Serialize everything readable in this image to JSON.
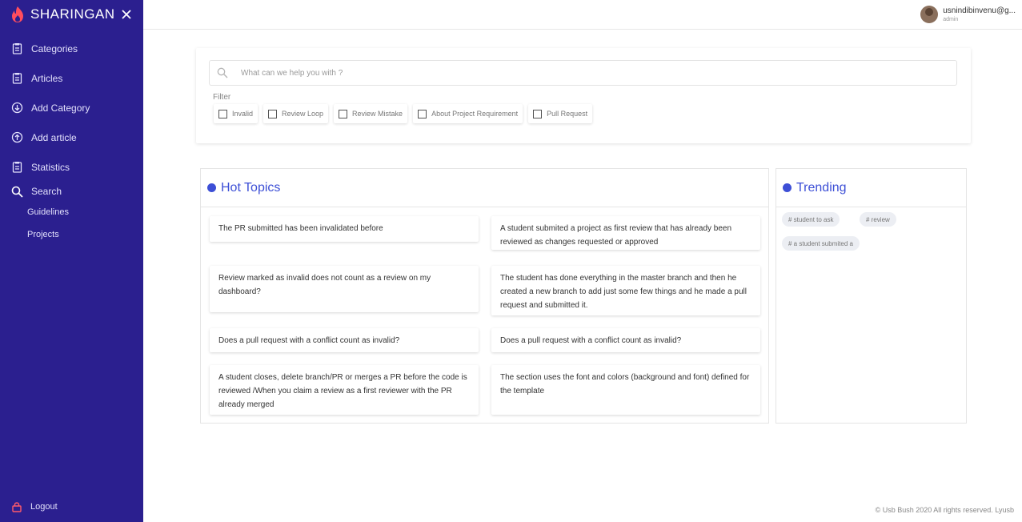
{
  "app": {
    "name": "SHARINGAN"
  },
  "sidebar": {
    "items": [
      {
        "label": "Categories",
        "icon": "clipboard-icon"
      },
      {
        "label": "Articles",
        "icon": "clipboard-icon"
      },
      {
        "label": "Add Category",
        "icon": "circle-down-icon"
      },
      {
        "label": "Add article",
        "icon": "circle-up-icon"
      },
      {
        "label": "Statistics",
        "icon": "clipboard-icon"
      },
      {
        "label": "Search",
        "icon": "search-icon"
      }
    ],
    "subitems": [
      {
        "label": "Guidelines"
      },
      {
        "label": "Projects"
      }
    ],
    "logout": "Logout"
  },
  "user": {
    "email": "usnindibinvenu@g...",
    "role": "admin"
  },
  "search": {
    "placeholder": "What can we help you with ?",
    "filter_label": "Filter",
    "filters": [
      "Invalid",
      "Review Loop",
      "Review Mistake",
      "About Project Requirement",
      "Pull Request"
    ]
  },
  "hot_topics": {
    "title": "Hot Topics",
    "items": [
      "The PR submitted has been invalidated before",
      "A student submited a project as first review that has already been reviewed as changes requested or approved",
      "Review marked as invalid does not count as a review on my dashboard?",
      "The student has done everything in the master branch and then he created a new branch to add just some few things and he made a pull request and submitted it.",
      "Does a pull request with a conflict count as invalid?",
      "Does a pull request with a conflict count as invalid?",
      "A student closes, delete branch/PR or merges a PR before the code is reviewed /When you claim a review as a first reviewer with the PR already merged",
      "The section uses the font and colors (background and font) defined for the template"
    ]
  },
  "trending": {
    "title": "Trending",
    "tags": [
      "# student to ask",
      "# review",
      "# a student submited a"
    ]
  },
  "footer": "© Usb Bush 2020 All rights reserved. Lyusb",
  "colors": {
    "sidebar": "#2b1f8f",
    "accent": "#3d4fd6",
    "brand_icon": "#ff4d5e"
  }
}
